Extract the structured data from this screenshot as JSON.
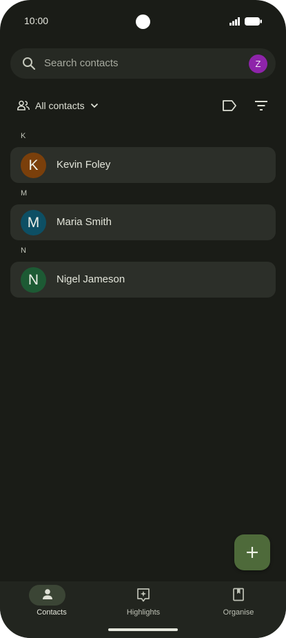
{
  "status_bar": {
    "time": "10:00"
  },
  "search": {
    "placeholder": "Search contacts",
    "account_initial": "Z"
  },
  "filter": {
    "label": "All contacts"
  },
  "sections": [
    {
      "letter": "K",
      "contact": {
        "initial": "K",
        "name": "Kevin Foley",
        "color": "#7a3f0b"
      }
    },
    {
      "letter": "M",
      "contact": {
        "initial": "M",
        "name": "Maria Smith",
        "color": "#0d4f64"
      }
    },
    {
      "letter": "N",
      "contact": {
        "initial": "N",
        "name": "Nigel Jameson",
        "color": "#1d5a34"
      }
    }
  ],
  "fab": {
    "icon": "plus-icon"
  },
  "nav": {
    "items": [
      {
        "label": "Contacts",
        "icon": "person-icon",
        "active": true
      },
      {
        "label": "Highlights",
        "icon": "highlights-icon",
        "active": false
      },
      {
        "label": "Organise",
        "icon": "bookmark-icon",
        "active": false
      }
    ]
  },
  "colors": {
    "background": "#1a1c17",
    "card": "#2c2f29",
    "accent": "#4e6a3a",
    "account_avatar": "#8e24aa"
  }
}
